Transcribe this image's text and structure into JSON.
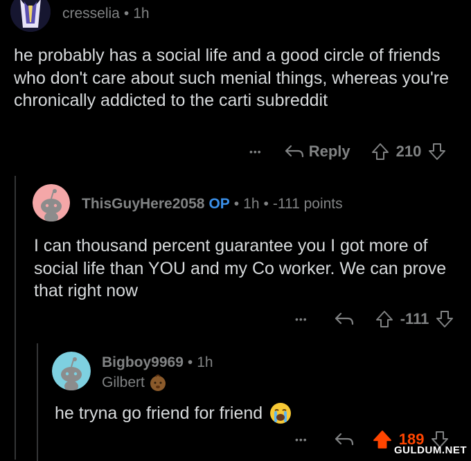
{
  "comments": [
    {
      "username": "cresselia",
      "dot": "•",
      "time": "1h",
      "body": "he probably has a social life and a good circle of friends who don't care about such menial things, whereas you're chronically addicted to the carti subreddit",
      "more": "•••",
      "reply_label": "Reply",
      "votes": "210"
    },
    {
      "username": "ThisGuyHere2058",
      "op_badge": "OP",
      "dot": "•",
      "time": "1h",
      "points": "-111 points",
      "body": "I can thousand percent guarantee you I got more of social life than YOU and my Co worker. We can prove that right now",
      "more": "•••",
      "votes": "-111",
      "avatar_bg": "#f4a7a8"
    },
    {
      "username": "Bigboy9969",
      "dot": "•",
      "time": "1h",
      "flair": "Gilbert",
      "body": "he tryna go friend for friend",
      "more": "•••",
      "votes": "189",
      "avatar_bg": "#7ed0e0"
    }
  ],
  "watermark": "GULDUM.NET",
  "colors": {
    "upvoted": "#ff4500",
    "op": "#3a8fe8",
    "meta": "#818384",
    "text": "#d7dadc"
  }
}
